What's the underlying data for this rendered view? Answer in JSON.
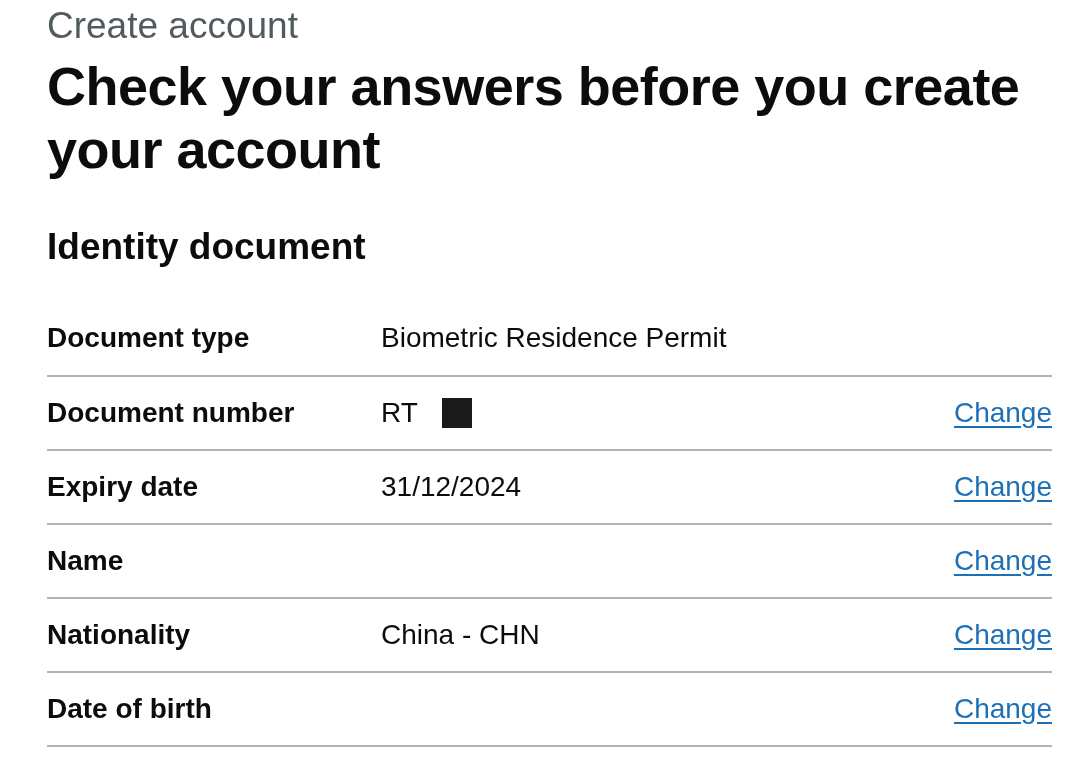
{
  "caption": "Create account",
  "heading": "Check your answers before you create your account",
  "section": {
    "title": "Identity document"
  },
  "rows": [
    {
      "key": "Document type",
      "value": "Biometric Residence Permit",
      "redacted": false
    },
    {
      "key": "Document number",
      "value": "RT",
      "redacted": true,
      "action": "Change"
    },
    {
      "key": "Expiry date",
      "value": "31/12/2024",
      "redacted": false,
      "action": "Change"
    },
    {
      "key": "Name",
      "redacted": false,
      "action": "Change"
    },
    {
      "key": "Nationality",
      "value": "China - CHN",
      "redacted": false,
      "action": "Change"
    },
    {
      "key": "Date of birth",
      "redacted": false,
      "action": "Change"
    }
  ]
}
